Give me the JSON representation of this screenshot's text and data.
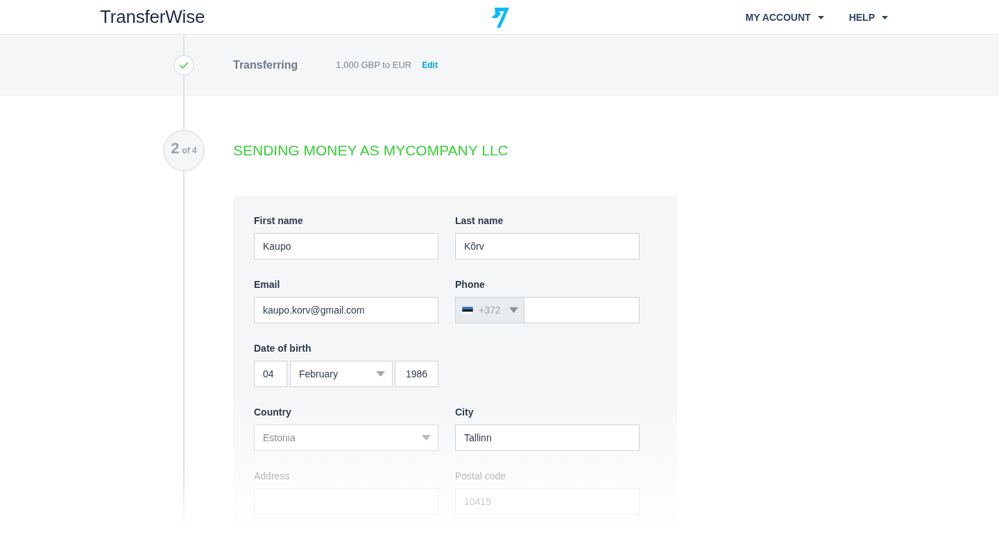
{
  "navbar": {
    "logo": "TransferWise",
    "menu": [
      {
        "label": "MY ACCOUNT"
      },
      {
        "label": "HELP"
      }
    ]
  },
  "completed_step": {
    "done": true,
    "title": "Transferring",
    "summary": "1,000 GBP to EUR",
    "edit_link": "Edit"
  },
  "current_step": {
    "number": "2",
    "total": "of 4",
    "title": "SENDING MONEY AS MYCOMPANY LLC"
  },
  "form": {
    "rows": [
      {
        "fields": [
          {
            "kind": "text",
            "label": "First name",
            "value": "Kaupo",
            "faded": false
          },
          {
            "kind": "text",
            "label": "Last name",
            "value": "Kõrv",
            "faded": false
          }
        ]
      },
      {
        "fields": [
          {
            "kind": "text",
            "label": "Email",
            "value": "kaupo.korv@gmail.com",
            "faded": false
          },
          {
            "kind": "phone",
            "label": "Phone",
            "dial_code": "+372",
            "faded": false
          }
        ]
      },
      {
        "fields": [
          {
            "kind": "date",
            "label": "Date of birth",
            "day": "04",
            "month": "February",
            "year": "1986",
            "faded": false
          }
        ]
      },
      {
        "fields": [
          {
            "kind": "select",
            "label": "Country",
            "value": "Estonia",
            "faded": false
          },
          {
            "kind": "text",
            "label": "City",
            "value": "Tallinn",
            "faded": false
          }
        ]
      },
      {
        "fields": [
          {
            "kind": "text",
            "label": "Address",
            "faded": true
          },
          {
            "kind": "text",
            "label": "Postal code",
            "value": "10415",
            "faded": true
          }
        ]
      }
    ]
  }
}
